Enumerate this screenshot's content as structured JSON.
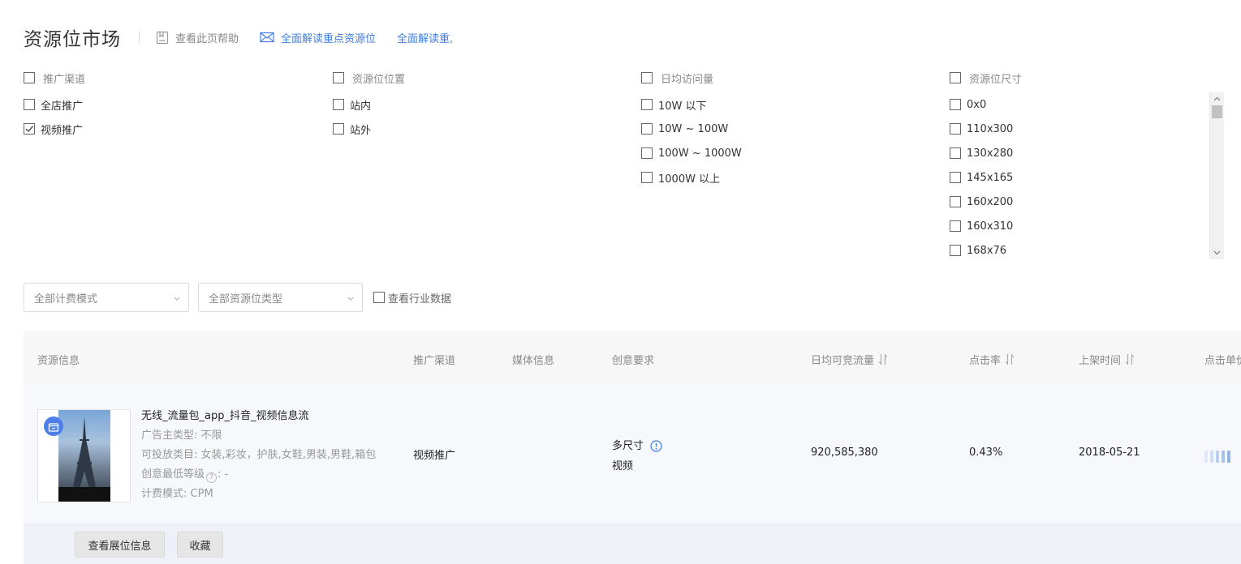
{
  "header": {
    "title": "资源位市场",
    "help_label": "查看此页帮助",
    "link1_label": "全面解读重点资源位",
    "link2_label": "全面解读重,"
  },
  "filters": {
    "channel": {
      "title": "推广渠道",
      "options": [
        {
          "label": "全店推广",
          "checked": false
        },
        {
          "label": "视频推广",
          "checked": true
        }
      ]
    },
    "position": {
      "title": "资源位位置",
      "options": [
        {
          "label": "站内",
          "checked": false
        },
        {
          "label": "站外",
          "checked": false
        }
      ]
    },
    "traffic": {
      "title": "日均访问量",
      "options": [
        {
          "label": "10W 以下",
          "checked": false
        },
        {
          "label": "10W ~ 100W",
          "checked": false
        },
        {
          "label": "100W ~ 1000W",
          "checked": false
        },
        {
          "label": "1000W 以上",
          "checked": false
        }
      ]
    },
    "size": {
      "title": "资源位尺寸",
      "options": [
        {
          "label": "0x0",
          "checked": false
        },
        {
          "label": "110x300",
          "checked": false
        },
        {
          "label": "130x280",
          "checked": false
        },
        {
          "label": "145x165",
          "checked": false
        },
        {
          "label": "160x200",
          "checked": false
        },
        {
          "label": "160x310",
          "checked": false
        },
        {
          "label": "168x76",
          "checked": false
        }
      ]
    }
  },
  "controls": {
    "billing_select": "全部计费模式",
    "type_select": "全部资源位类型",
    "industry_label": "查看行业数据",
    "industry_checked": false
  },
  "table": {
    "headers": {
      "info": "资源信息",
      "channel": "推广渠道",
      "media": "媒体信息",
      "creative": "创意要求",
      "traffic": "日均可竞流量",
      "ctr": "点击率",
      "date": "上架时间",
      "cpc": "点击单价"
    },
    "row": {
      "name": "无线_流量包_app_抖音_视频信息流",
      "advertiser_label": "广告主类型:",
      "advertiser_value": "不限",
      "categories_label": "可投放类目:",
      "categories_value": "女装,彩妆，护肤,女鞋,男装,男鞋,箱包",
      "level_label": "创意最低等级",
      "level_value": ": -",
      "billing_label": "计费模式:",
      "billing_value": "CPM",
      "channel": "视频推广",
      "creative_line1": "多尺寸",
      "creative_line2": "视频",
      "traffic": "920,585,380",
      "ctr": "0.43%",
      "date": "2018-05-21"
    },
    "actions": {
      "view_label": "查看展位信息",
      "fav_label": "收藏"
    }
  },
  "colors": {
    "accent": "#3d7ee0",
    "badge": "#4d7fe8"
  }
}
